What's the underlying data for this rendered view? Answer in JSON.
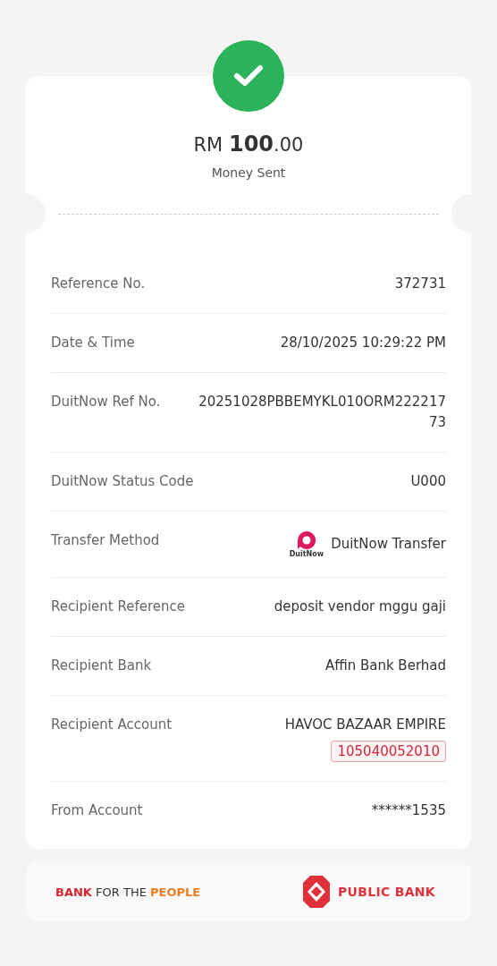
{
  "amount": {
    "currency": "RM",
    "whole": "100",
    "decimals": ".00",
    "caption": "Money Sent"
  },
  "details": [
    {
      "kind": "text",
      "label": "Reference No.",
      "value": "372731"
    },
    {
      "kind": "text",
      "label": "Date & Time",
      "value": "28/10/2025 10:29:22 PM"
    },
    {
      "kind": "text",
      "label": "DuitNow Ref No.",
      "value": "20251028PBBEMYKL010ORM22221773"
    },
    {
      "kind": "text",
      "label": "DuitNow Status Code",
      "value": "U000"
    },
    {
      "kind": "method",
      "label": "Transfer Method",
      "logo_caption": "DuitNow",
      "value": "DuitNow Transfer"
    },
    {
      "kind": "text",
      "label": "Recipient Reference",
      "value": "deposit vendor mggu gaji"
    },
    {
      "kind": "text",
      "label": "Recipient Bank",
      "value": "Affin Bank Berhad"
    },
    {
      "kind": "account",
      "label": "Recipient Account",
      "value": "HAVOC BAZAAR EMPIRE",
      "account": "105040052010"
    },
    {
      "kind": "text",
      "label": "From Account",
      "value": "******1535"
    }
  ],
  "footer": {
    "tagline": "**BANK** FOR THE **PEOPLE**",
    "bank_name": "PUBLIC BANK"
  }
}
